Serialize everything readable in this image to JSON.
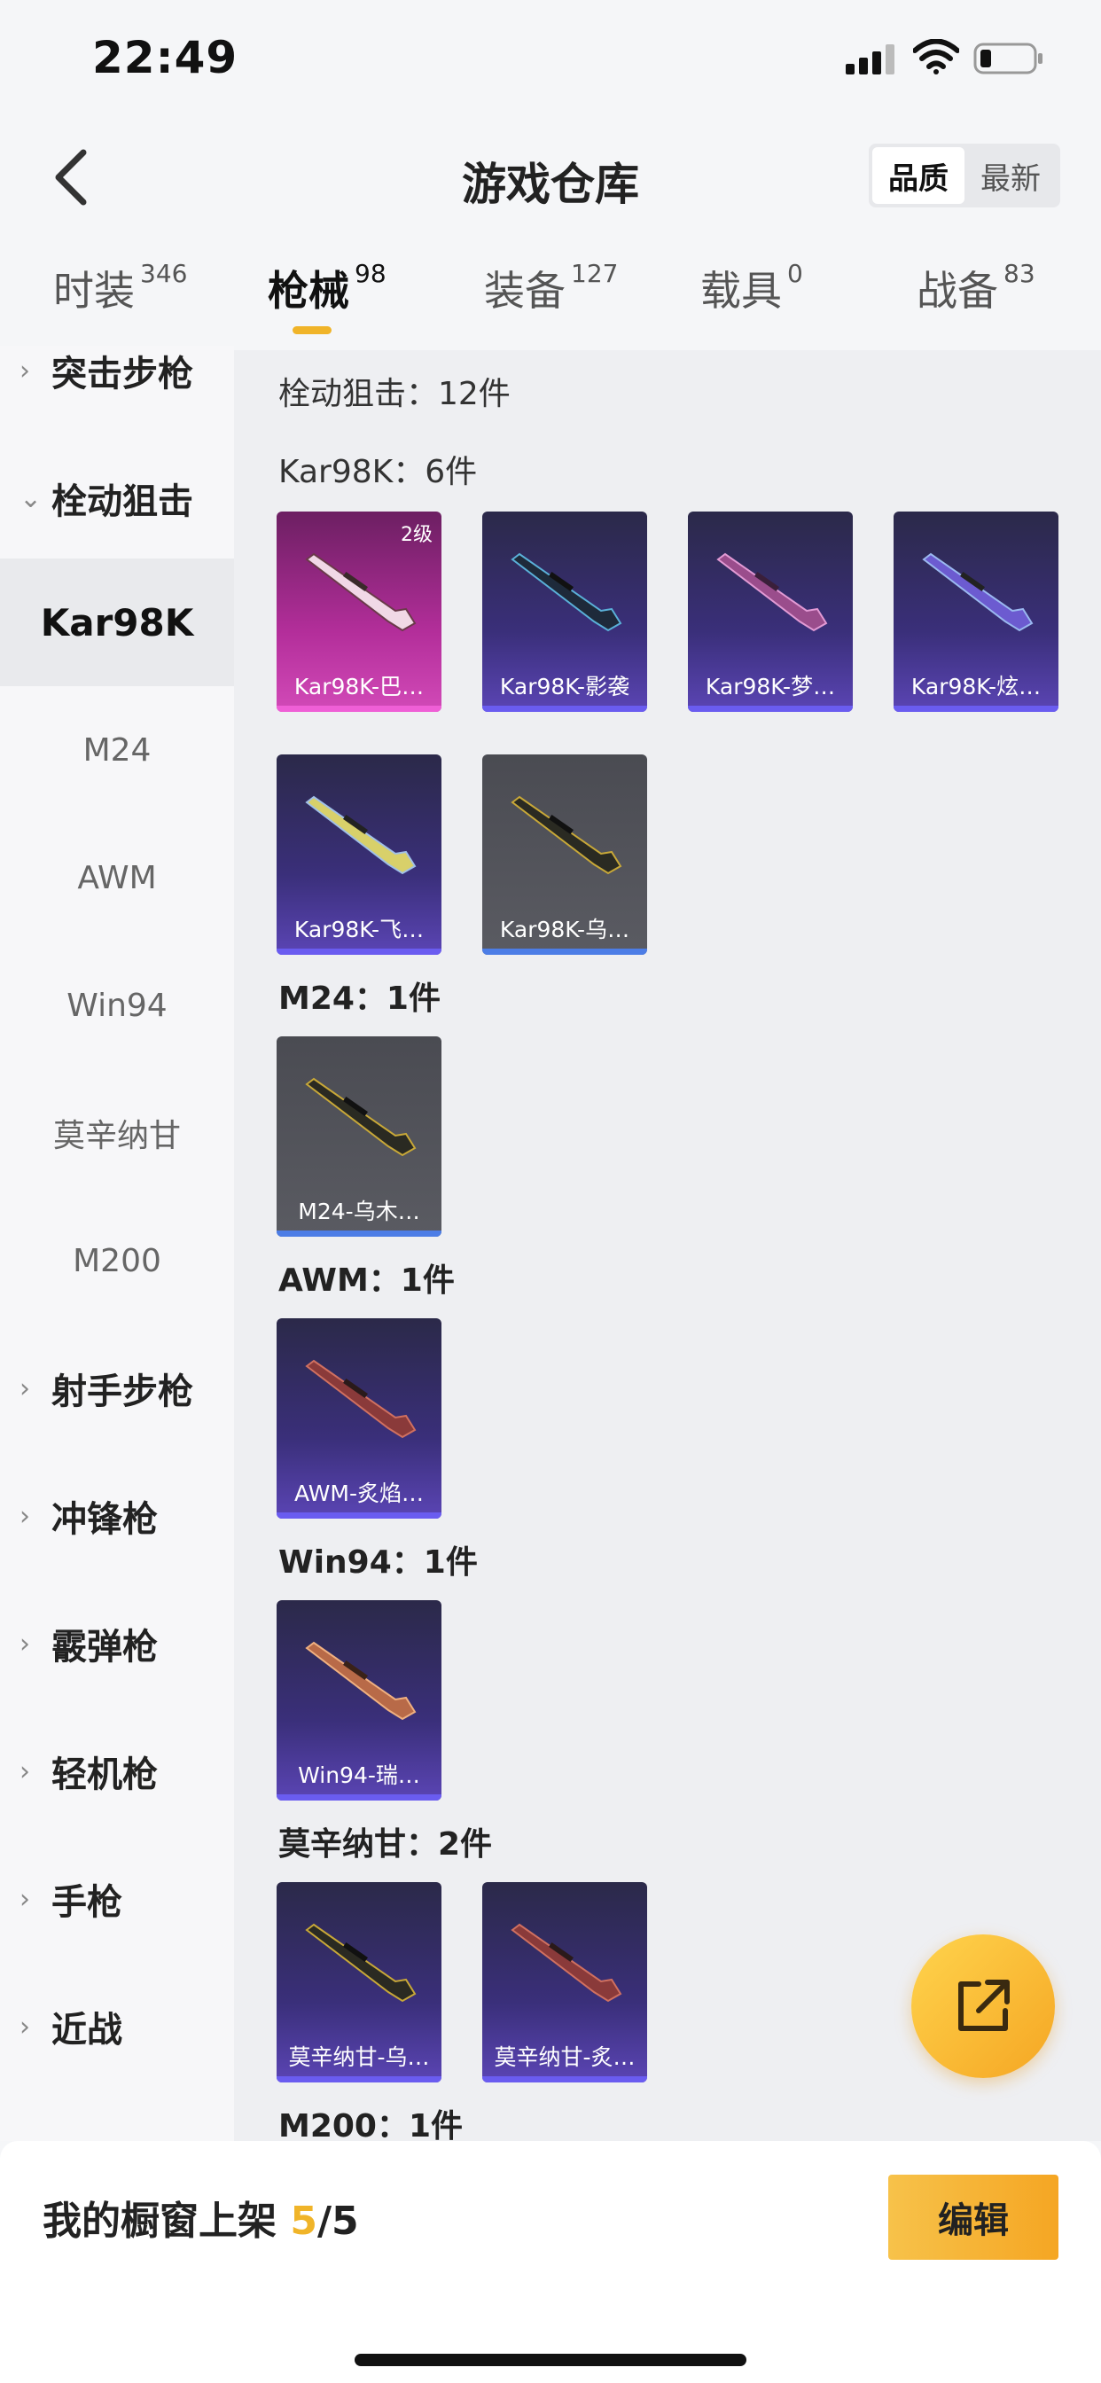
{
  "status_bar": {
    "time": "22:49"
  },
  "nav": {
    "title": "游戏仓库",
    "sort_options": [
      "品质",
      "最新"
    ],
    "active_sort": "品质"
  },
  "tabs": [
    {
      "label": "时装",
      "count": "346"
    },
    {
      "label": "枪械",
      "count": "98"
    },
    {
      "label": "装备",
      "count": "127"
    },
    {
      "label": "载具",
      "count": "0"
    },
    {
      "label": "战备",
      "count": "83"
    }
  ],
  "active_tab": "枪械",
  "sidebar": {
    "groups": [
      {
        "label": "突击步枪",
        "chevron": "›"
      },
      {
        "label": "栓动狙击",
        "chevron": "⌄"
      },
      {
        "label": "射手步枪",
        "chevron": "›"
      },
      {
        "label": "冲锋枪",
        "chevron": "›"
      },
      {
        "label": "霰弹枪",
        "chevron": "›"
      },
      {
        "label": "轻机枪",
        "chevron": "›"
      },
      {
        "label": "手枪",
        "chevron": "›"
      },
      {
        "label": "近战",
        "chevron": "›"
      }
    ],
    "sub_items": [
      "Kar98K",
      "M24",
      "AWM",
      "Win94",
      "莫辛纳甘",
      "M200"
    ],
    "active_sub": "Kar98K"
  },
  "content": {
    "category_summary": "栓动狙击：12件",
    "sections": [
      {
        "label": "Kar98K：6件",
        "items": [
          {
            "name": "Kar98K-巴…",
            "level": "2级",
            "rarity": "pink"
          },
          {
            "name": "Kar98K-影袭",
            "level": "",
            "rarity": "purple"
          },
          {
            "name": "Kar98K-梦…",
            "level": "",
            "rarity": "purple"
          },
          {
            "name": "Kar98K-炫…",
            "level": "",
            "rarity": "purple"
          },
          {
            "name": "Kar98K-飞…",
            "level": "",
            "rarity": "purple"
          },
          {
            "name": "Kar98K-乌…",
            "level": "",
            "rarity": "gray"
          }
        ]
      },
      {
        "label": "M24：1件",
        "items": [
          {
            "name": "M24-乌木…",
            "level": "",
            "rarity": "gray"
          }
        ]
      },
      {
        "label": "AWM：1件",
        "items": [
          {
            "name": "AWM-炙焰…",
            "level": "",
            "rarity": "purple"
          }
        ]
      },
      {
        "label": "Win94：1件",
        "items": [
          {
            "name": "Win94-瑞…",
            "level": "",
            "rarity": "purple"
          }
        ]
      },
      {
        "label": "莫辛纳甘：2件",
        "items": [
          {
            "name": "莫辛纳甘-乌…",
            "level": "",
            "rarity": "purple"
          },
          {
            "name": "莫辛纳甘-炙…",
            "level": "",
            "rarity": "purple"
          }
        ]
      },
      {
        "label": "M200：1件",
        "items": []
      }
    ]
  },
  "bottom_bar": {
    "label": "我的橱窗上架 ",
    "current": "5",
    "total": "/5",
    "edit_label": "编辑"
  },
  "colors": {
    "accent": "#f0b429",
    "rarity_pink": "#d24ab8",
    "rarity_purple": "#5b45b5",
    "rarity_gray": "#5a5b62"
  }
}
